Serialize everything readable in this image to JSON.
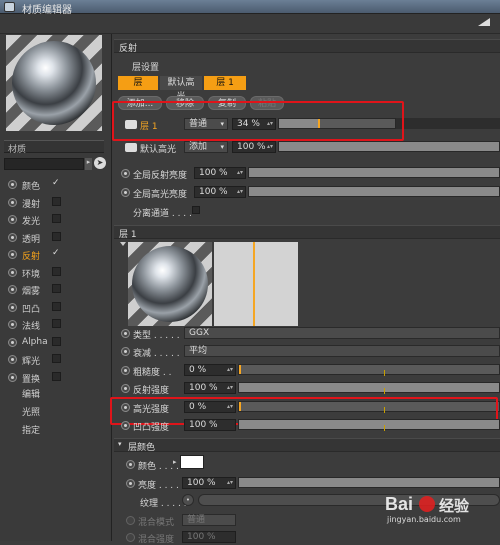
{
  "window": {
    "title": "材质编辑器"
  },
  "material": {
    "name": "材质"
  },
  "channels": [
    {
      "label": "颜色",
      "checked": true
    },
    {
      "label": "漫射",
      "checked": false
    },
    {
      "label": "发光",
      "checked": false
    },
    {
      "label": "透明",
      "checked": false
    },
    {
      "label": "反射",
      "checked": true
    },
    {
      "label": "环境",
      "checked": false
    },
    {
      "label": "烟雾",
      "checked": false
    },
    {
      "label": "凹凸",
      "checked": false
    },
    {
      "label": "法线",
      "checked": false
    },
    {
      "label": "Alpha",
      "checked": false
    },
    {
      "label": "辉光",
      "checked": false
    },
    {
      "label": "置换",
      "checked": false
    }
  ],
  "extras": [
    "编辑",
    "光照",
    "指定"
  ],
  "checkmark": "✓",
  "reflect": {
    "header": "反射",
    "layer_settings": "层设置",
    "tabs": [
      "层",
      "默认高光",
      "层 1"
    ],
    "buttons": [
      "添加...",
      "移除",
      "复制",
      "粘贴"
    ],
    "layer1": {
      "name": "层 1",
      "mode": "普通",
      "value": "34 %",
      "percent": 34
    },
    "default_spec": {
      "name": "默认高光",
      "mode": "添加",
      "value": "100 %",
      "percent": 100
    },
    "global_reflect": {
      "label": "全局反射亮度",
      "value": "100 %"
    },
    "global_spec": {
      "label": "全局高光亮度",
      "value": "100 %"
    },
    "separate": "分离通道 . . . ."
  },
  "layer_panel": {
    "header": "层 1",
    "type": {
      "label": "类型 . . . . .",
      "value": "GGX"
    },
    "attenuation": {
      "label": "衰减 . . . . .",
      "value": "平均"
    },
    "roughness": {
      "label": "粗糙度 . .",
      "value": "0 %"
    },
    "reflect_strength": {
      "label": "反射强度",
      "value": "100 %"
    },
    "spec_strength": {
      "label": "高光强度",
      "value": "0 %"
    },
    "bump_strength": {
      "label": "凹凸强度",
      "value": "100 %"
    }
  },
  "layer_color": {
    "header": "层颜色",
    "color_label": "颜色 . . . . .",
    "color_value": "#ffffff",
    "brightness": {
      "label": "亮度 . . . .",
      "value": "100 %"
    },
    "texture_label": "纹理 . . . . .",
    "blend_mode": {
      "label": "混合模式",
      "value": "普通"
    },
    "blend_strength": {
      "label": "混合强度",
      "value": "100 %"
    }
  },
  "watermark": {
    "brand": "Bai",
    "brand2": "经验",
    "url": "jingyan.baidu.com"
  },
  "colors": {
    "accent": "#f59e14",
    "highlight": "#e0141a"
  }
}
